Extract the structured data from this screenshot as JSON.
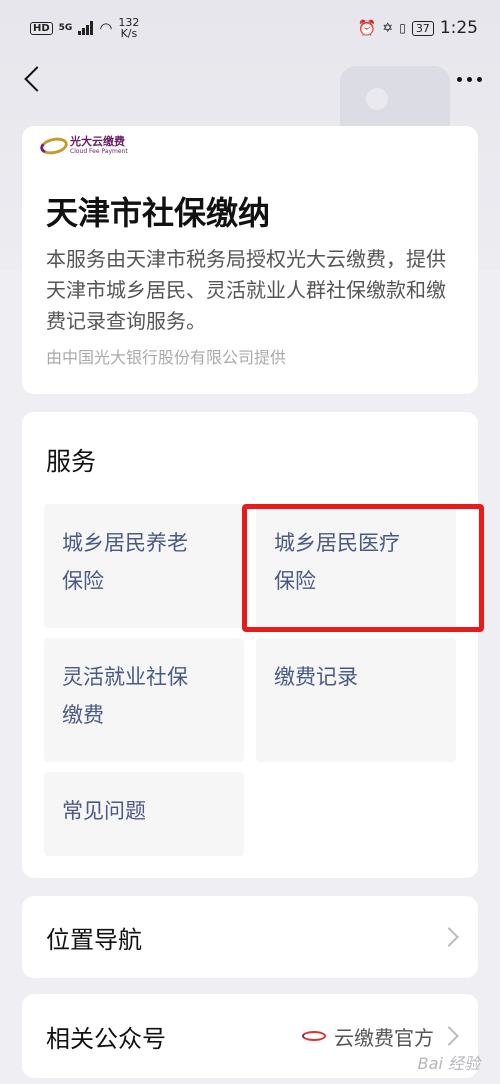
{
  "status_bar": {
    "hd": "HD",
    "network": "5G",
    "speed_value": "132",
    "speed_unit": "K/s",
    "battery": "37",
    "time": "1:25"
  },
  "intro": {
    "logo_cn": "光大云缴费",
    "logo_en": "Cloud Fee Payment",
    "title": "天津市社保缴纳",
    "description": "本服务由天津市税务局授权光大云缴费，提供天津市城乡居民、灵活就业人群社保缴款和缴费记录查询服务。",
    "provider": "由中国光大银行股份有限公司提供"
  },
  "services": {
    "title": "服务",
    "items": [
      {
        "line1": "城乡居民养老",
        "line2": "保险"
      },
      {
        "line1": "城乡居民医疗",
        "line2": "保险"
      },
      {
        "line1": "灵活就业社保",
        "line2": "缴费"
      },
      {
        "line1": "缴费记录",
        "line2": ""
      },
      {
        "line1": "常见问题",
        "line2": ""
      }
    ]
  },
  "rows": {
    "location_nav": "位置导航",
    "official_account_label": "相关公众号",
    "official_account_value": "云缴费官方"
  },
  "watermark": "Bai 经验",
  "colors": {
    "highlight": "#e81a1a",
    "service_text": "#4a5a85"
  }
}
